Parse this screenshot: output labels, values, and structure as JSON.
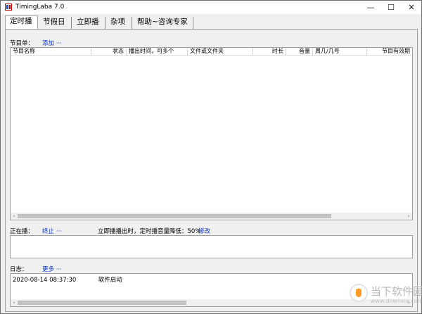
{
  "window": {
    "title": "TimingLaba 7.0",
    "min_glyph": "—",
    "max_glyph": "☐",
    "close_glyph": "✕"
  },
  "tabs": [
    {
      "label": "定时播",
      "active": true
    },
    {
      "label": "节假日"
    },
    {
      "label": "立即播"
    },
    {
      "label": "杂项"
    },
    {
      "label": "帮助~咨询专家"
    }
  ],
  "program_list": {
    "label": "节目单：",
    "add_link": "添加 ···",
    "columns": [
      "节目名称",
      "状态",
      "播出时间，可多个",
      "文件或文件夹",
      "时长",
      "音量",
      "周几/几号",
      "节目有效期"
    ]
  },
  "now_playing": {
    "label": "正在播：",
    "stop_link": "终止 ···",
    "info": "立即播播出时，定时播音量降低：50%",
    "edit_link": "修改"
  },
  "log": {
    "label": "日志：",
    "more_link": "更多 ···",
    "entries": [
      {
        "time": "2020-08-14 08:37:30",
        "message": "软件启动"
      }
    ]
  },
  "scroll_glyphs": {
    "left": "‹",
    "right": "›"
  },
  "watermark": {
    "text": "当下软件园",
    "sub": "www.downxia.com"
  }
}
